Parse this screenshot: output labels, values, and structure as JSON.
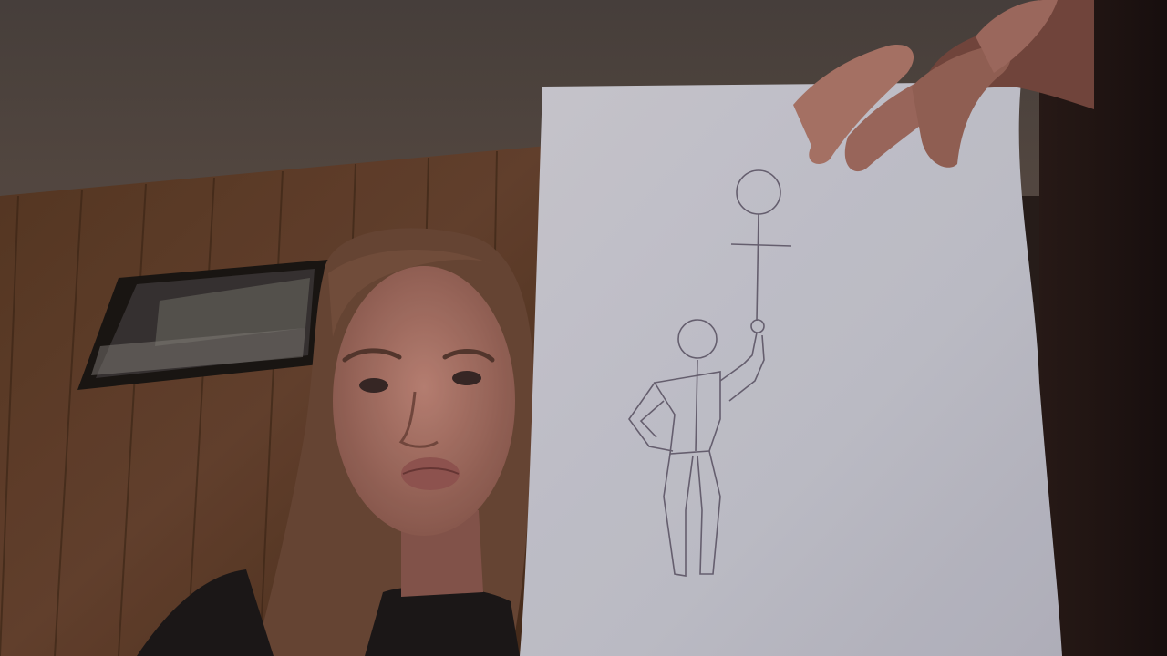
{
  "scene": {
    "description_items": [
      "ceiling",
      "wood-panel-wall",
      "framed-picture",
      "person",
      "paper-with-pencil-sketch",
      "holding-hand"
    ]
  },
  "colors": {
    "ceiling": "#4a3f39",
    "wall_wood": "#5a3a25",
    "wall_wood_dark": "#3f2718",
    "paper": "#cfcfd6",
    "paper_shadow": "#b9b8c2",
    "pencil": "#6e6778",
    "skin": "#b47a6e",
    "skin_dark": "#8d5a50",
    "hair": "#6e4a38",
    "shirt": "#1e1a1a",
    "right_dark": "#1f1412"
  }
}
